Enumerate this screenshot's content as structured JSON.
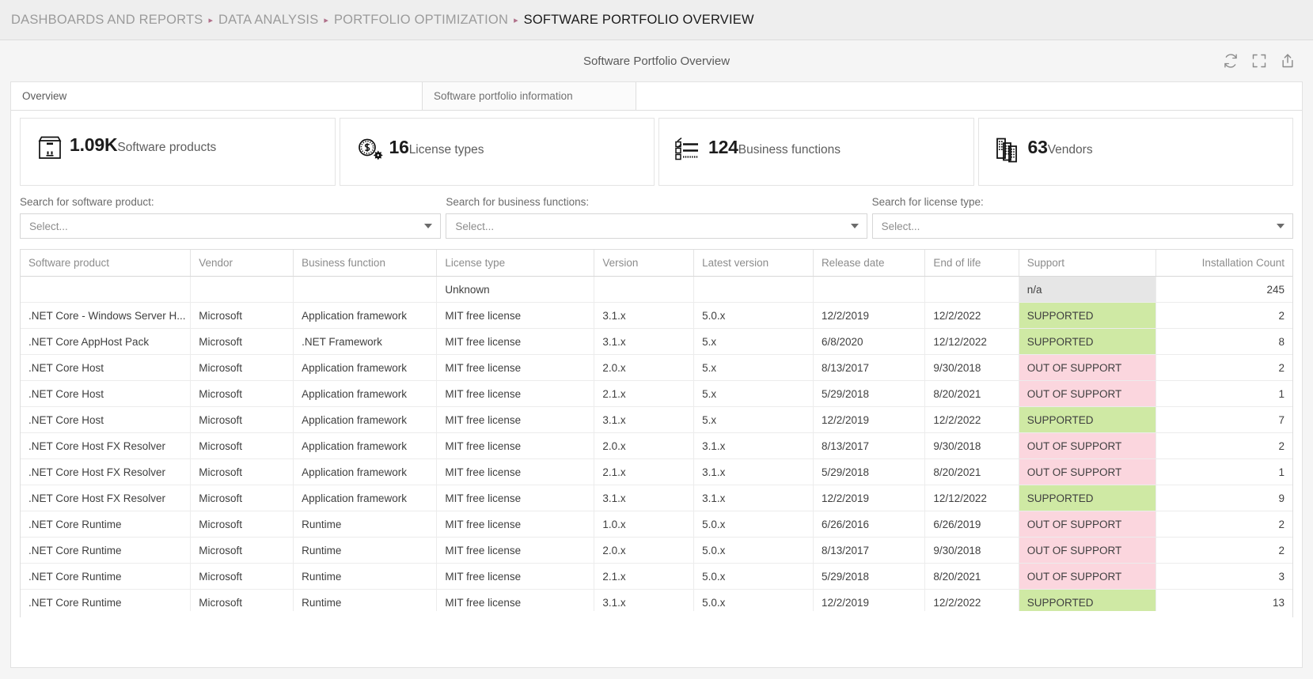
{
  "breadcrumb": {
    "separator": "▸",
    "items": [
      {
        "label": "DASHBOARDS AND REPORTS",
        "current": false
      },
      {
        "label": "DATA ANALYSIS",
        "current": false
      },
      {
        "label": "PORTFOLIO OPTIMIZATION",
        "current": false
      },
      {
        "label": "SOFTWARE PORTFOLIO OVERVIEW",
        "current": true
      }
    ]
  },
  "dashboard": {
    "title": "Software Portfolio Overview",
    "tools": [
      {
        "name": "refresh-icon",
        "label": "Refresh"
      },
      {
        "name": "fullscreen-icon",
        "label": "Fullscreen"
      },
      {
        "name": "share-icon",
        "label": "Share"
      }
    ]
  },
  "tabs": [
    {
      "label": "Overview",
      "active": true
    },
    {
      "label": "Software portfolio information",
      "active": false
    }
  ],
  "kpis": [
    {
      "icon": "package-icon",
      "value": "1.09K",
      "label": "Software products"
    },
    {
      "icon": "license-coin-icon",
      "value": "16",
      "label": "License types"
    },
    {
      "icon": "checklist-icon",
      "value": "124",
      "label": "Business functions"
    },
    {
      "icon": "buildings-icon",
      "value": "63",
      "label": "Vendors"
    }
  ],
  "filters": [
    {
      "label": "Search for software product:",
      "placeholder": "Select...",
      "value": ""
    },
    {
      "label": "Search for business functions:",
      "placeholder": "Select...",
      "value": ""
    },
    {
      "label": "Search for license type:",
      "placeholder": "Select...",
      "value": ""
    }
  ],
  "table": {
    "columns": [
      "Software product",
      "Vendor",
      "Business function",
      "License type",
      "Version",
      "Latest version",
      "Release date",
      "End of life",
      "Support",
      "Installation Count"
    ],
    "rows": [
      {
        "product": "",
        "vendor": "",
        "business_function": "",
        "license_type": "Unknown",
        "version": "",
        "latest_version": "",
        "release_date": "",
        "end_of_life": "",
        "support": "n/a",
        "support_state": "na",
        "count": "245"
      },
      {
        "product": ".NET Core - Windows Server H...",
        "vendor": "Microsoft",
        "business_function": "Application framework",
        "license_type": "MIT free license",
        "version": "3.1.x",
        "latest_version": "5.0.x",
        "release_date": "12/2/2019",
        "end_of_life": "12/2/2022",
        "support": "SUPPORTED",
        "support_state": "sup",
        "count": "2"
      },
      {
        "product": ".NET Core AppHost Pack",
        "vendor": "Microsoft",
        "business_function": ".NET Framework",
        "license_type": "MIT free license",
        "version": "3.1.x",
        "latest_version": "5.x",
        "release_date": "6/8/2020",
        "end_of_life": "12/12/2022",
        "support": "SUPPORTED",
        "support_state": "sup",
        "count": "8"
      },
      {
        "product": ".NET Core Host",
        "vendor": "Microsoft",
        "business_function": "Application framework",
        "license_type": "MIT free license",
        "version": "2.0.x",
        "latest_version": "5.x",
        "release_date": "8/13/2017",
        "end_of_life": "9/30/2018",
        "support": "OUT OF SUPPORT",
        "support_state": "oos",
        "count": "2"
      },
      {
        "product": ".NET Core Host",
        "vendor": "Microsoft",
        "business_function": "Application framework",
        "license_type": "MIT free license",
        "version": "2.1.x",
        "latest_version": "5.x",
        "release_date": "5/29/2018",
        "end_of_life": "8/20/2021",
        "support": "OUT OF SUPPORT",
        "support_state": "oos",
        "count": "1"
      },
      {
        "product": ".NET Core Host",
        "vendor": "Microsoft",
        "business_function": "Application framework",
        "license_type": "MIT free license",
        "version": "3.1.x",
        "latest_version": "5.x",
        "release_date": "12/2/2019",
        "end_of_life": "12/2/2022",
        "support": "SUPPORTED",
        "support_state": "sup",
        "count": "7"
      },
      {
        "product": ".NET Core Host FX Resolver",
        "vendor": "Microsoft",
        "business_function": "Application framework",
        "license_type": "MIT free license",
        "version": "2.0.x",
        "latest_version": "3.1.x",
        "release_date": "8/13/2017",
        "end_of_life": "9/30/2018",
        "support": "OUT OF SUPPORT",
        "support_state": "oos",
        "count": "2"
      },
      {
        "product": ".NET Core Host FX Resolver",
        "vendor": "Microsoft",
        "business_function": "Application framework",
        "license_type": "MIT free license",
        "version": "2.1.x",
        "latest_version": "3.1.x",
        "release_date": "5/29/2018",
        "end_of_life": "8/20/2021",
        "support": "OUT OF SUPPORT",
        "support_state": "oos",
        "count": "1"
      },
      {
        "product": ".NET Core Host FX Resolver",
        "vendor": "Microsoft",
        "business_function": "Application framework",
        "license_type": "MIT free license",
        "version": "3.1.x",
        "latest_version": "3.1.x",
        "release_date": "12/2/2019",
        "end_of_life": "12/12/2022",
        "support": "SUPPORTED",
        "support_state": "sup",
        "count": "9"
      },
      {
        "product": ".NET Core Runtime",
        "vendor": "Microsoft",
        "business_function": "Runtime",
        "license_type": "MIT free license",
        "version": "1.0.x",
        "latest_version": "5.0.x",
        "release_date": "6/26/2016",
        "end_of_life": "6/26/2019",
        "support": "OUT OF SUPPORT",
        "support_state": "oos",
        "count": "2"
      },
      {
        "product": ".NET Core Runtime",
        "vendor": "Microsoft",
        "business_function": "Runtime",
        "license_type": "MIT free license",
        "version": "2.0.x",
        "latest_version": "5.0.x",
        "release_date": "8/13/2017",
        "end_of_life": "9/30/2018",
        "support": "OUT OF SUPPORT",
        "support_state": "oos",
        "count": "2"
      },
      {
        "product": ".NET Core Runtime",
        "vendor": "Microsoft",
        "business_function": "Runtime",
        "license_type": "MIT free license",
        "version": "2.1.x",
        "latest_version": "5.0.x",
        "release_date": "5/29/2018",
        "end_of_life": "8/20/2021",
        "support": "OUT OF SUPPORT",
        "support_state": "oos",
        "count": "3"
      },
      {
        "product": ".NET Core Runtime",
        "vendor": "Microsoft",
        "business_function": "Runtime",
        "license_type": "MIT free license",
        "version": "3.1.x",
        "latest_version": "5.0.x",
        "release_date": "12/2/2019",
        "end_of_life": "12/2/2022",
        "support": "SUPPORTED",
        "support_state": "sup",
        "count": "13"
      },
      {
        "product": "",
        "vendor": "",
        "business_function": "",
        "license_type": "",
        "version": "",
        "latest_version": "",
        "release_date": "",
        "end_of_life": "",
        "support": "",
        "support_state": "oos",
        "count": ""
      }
    ]
  },
  "colors": {
    "supported_bg": "#cfe9a4",
    "out_of_support_bg": "#fbd6de",
    "na_bg": "#e6e6e6",
    "link": "#3b73c4",
    "breadcrumb_bar": "#eeeeee",
    "dashboard_bg": "#f5f5f5"
  }
}
